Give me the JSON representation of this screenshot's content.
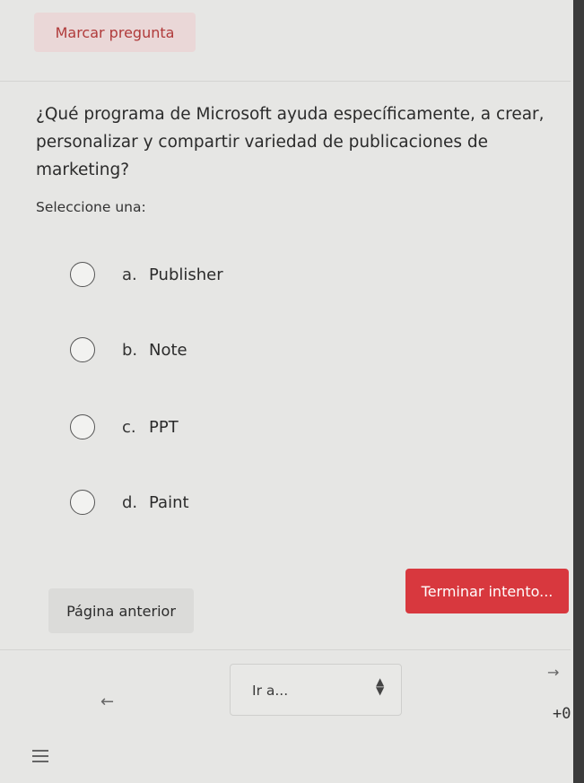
{
  "flag_label": "Marcar pregunta",
  "question_text": "¿Qué programa de Microsoft ayuda específicamente, a crear, personalizar y compartir variedad de publicaciones de marketing?",
  "prompt": "Seleccione una:",
  "options": [
    {
      "letter": "a.",
      "text": "Publisher"
    },
    {
      "letter": "b.",
      "text": "Note"
    },
    {
      "letter": "c.",
      "text": "PPT"
    },
    {
      "letter": "d.",
      "text": "Paint"
    }
  ],
  "nav": {
    "prev_label": "Página anterior",
    "finish_label": "Terminar intento...",
    "goto_label": "Ir a..."
  },
  "side_indicator": "+0",
  "colors": {
    "accent": "#d8383e",
    "flag_text": "#b03a3a",
    "flag_bg": "#ead7d7"
  }
}
